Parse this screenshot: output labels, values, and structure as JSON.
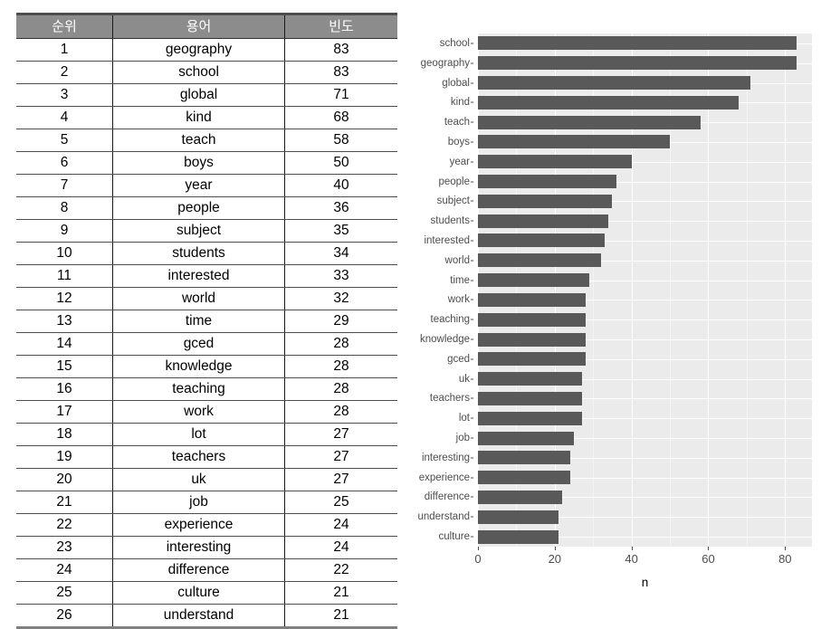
{
  "table": {
    "headers": [
      "순위",
      "용어",
      "빈도"
    ],
    "rows": [
      {
        "rank": "1",
        "term": "geography",
        "freq": "83"
      },
      {
        "rank": "2",
        "term": "school",
        "freq": "83"
      },
      {
        "rank": "3",
        "term": "global",
        "freq": "71"
      },
      {
        "rank": "4",
        "term": "kind",
        "freq": "68"
      },
      {
        "rank": "5",
        "term": "teach",
        "freq": "58"
      },
      {
        "rank": "6",
        "term": "boys",
        "freq": "50"
      },
      {
        "rank": "7",
        "term": "year",
        "freq": "40"
      },
      {
        "rank": "8",
        "term": "people",
        "freq": "36"
      },
      {
        "rank": "9",
        "term": "subject",
        "freq": "35"
      },
      {
        "rank": "10",
        "term": "students",
        "freq": "34"
      },
      {
        "rank": "11",
        "term": "interested",
        "freq": "33"
      },
      {
        "rank": "12",
        "term": "world",
        "freq": "32"
      },
      {
        "rank": "13",
        "term": "time",
        "freq": "29"
      },
      {
        "rank": "14",
        "term": "gced",
        "freq": "28"
      },
      {
        "rank": "15",
        "term": "knowledge",
        "freq": "28"
      },
      {
        "rank": "16",
        "term": "teaching",
        "freq": "28"
      },
      {
        "rank": "17",
        "term": "work",
        "freq": "28"
      },
      {
        "rank": "18",
        "term": "lot",
        "freq": "27"
      },
      {
        "rank": "19",
        "term": "teachers",
        "freq": "27"
      },
      {
        "rank": "20",
        "term": "uk",
        "freq": "27"
      },
      {
        "rank": "21",
        "term": "job",
        "freq": "25"
      },
      {
        "rank": "22",
        "term": "experience",
        "freq": "24"
      },
      {
        "rank": "23",
        "term": "interesting",
        "freq": "24"
      },
      {
        "rank": "24",
        "term": "difference",
        "freq": "22"
      },
      {
        "rank": "25",
        "term": "culture",
        "freq": "21"
      },
      {
        "rank": "26",
        "term": "understand",
        "freq": "21"
      }
    ]
  },
  "chart_data": {
    "type": "bar",
    "orientation": "horizontal",
    "title": "",
    "xlabel": "n",
    "ylabel": "",
    "xlim": [
      0,
      87
    ],
    "xticks": [
      0,
      20,
      40,
      60,
      80
    ],
    "xtick_labels": [
      "0",
      "20",
      "40",
      "60",
      "80"
    ],
    "grid": true,
    "legend": false,
    "bar_color": "#595959",
    "panel_color": "#ebebeb",
    "gridline_color": "#ffffff",
    "axis_text_color": "#4d4d4d",
    "categories": [
      "school",
      "geography",
      "global",
      "kind",
      "teach",
      "boys",
      "year",
      "people",
      "subject",
      "students",
      "interested",
      "world",
      "time",
      "work",
      "teaching",
      "knowledge",
      "gced",
      "uk",
      "teachers",
      "lot",
      "job",
      "interesting",
      "experience",
      "difference",
      "understand",
      "culture"
    ],
    "values": [
      83,
      83,
      71,
      68,
      58,
      50,
      40,
      36,
      35,
      34,
      33,
      32,
      29,
      28,
      28,
      28,
      28,
      27,
      27,
      27,
      25,
      24,
      24,
      22,
      21,
      21
    ]
  }
}
